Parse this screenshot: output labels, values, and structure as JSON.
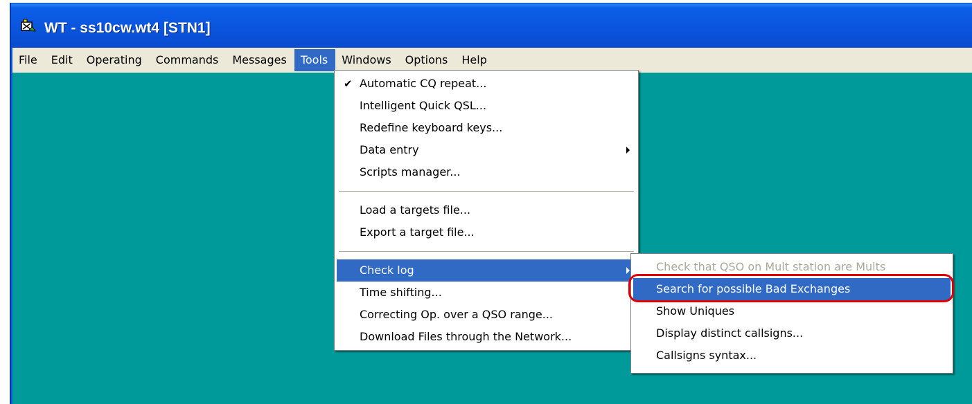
{
  "window": {
    "title": "WT - ss10cw.wt4 [STN1]",
    "icon": "wt-app-icon"
  },
  "menubar": {
    "items": [
      {
        "label": "File"
      },
      {
        "label": "Edit"
      },
      {
        "label": "Operating"
      },
      {
        "label": "Commands"
      },
      {
        "label": "Messages"
      },
      {
        "label": "Tools",
        "active": true
      },
      {
        "label": "Windows"
      },
      {
        "label": "Options"
      },
      {
        "label": "Help"
      }
    ]
  },
  "tools_menu": {
    "items": [
      {
        "label": "Automatic CQ repeat...",
        "checked": true
      },
      {
        "label": "Intelligent Quick QSL..."
      },
      {
        "label": "Redefine keyboard keys..."
      },
      {
        "label": "Data entry",
        "submenu": true
      },
      {
        "label": "Scripts manager..."
      },
      {
        "label": "Load a targets file..."
      },
      {
        "label": "Export a target file..."
      },
      {
        "label": "Check log",
        "submenu": true,
        "highlighted": true
      },
      {
        "label": "Time shifting..."
      },
      {
        "label": "Correcting Op. over a QSO range..."
      },
      {
        "label": "Download Files through the Network..."
      }
    ]
  },
  "check_log_submenu": {
    "items": [
      {
        "label": "Check that QSO on Mult station are Mults",
        "disabled": true
      },
      {
        "label": "Search for possible Bad Exchanges",
        "highlighted": true
      },
      {
        "label": "Show Uniques"
      },
      {
        "label": "Display distinct callsigns..."
      },
      {
        "label": "Callsigns syntax..."
      }
    ]
  },
  "colors": {
    "title_bar": "#0b55dd",
    "client_area": "#009a9a",
    "menu_highlight": "#316ac5",
    "annotation": "#e00000"
  }
}
